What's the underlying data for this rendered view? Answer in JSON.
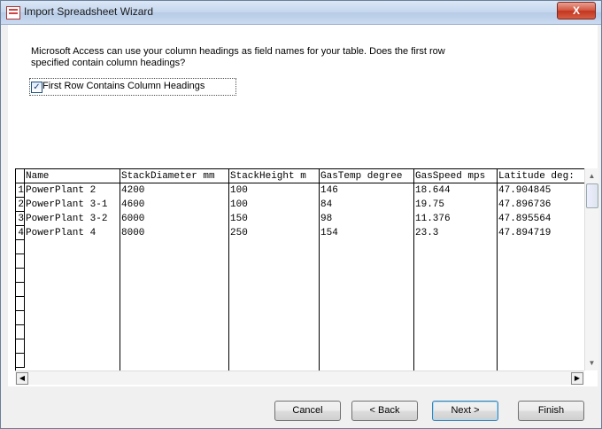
{
  "window": {
    "title": "Import Spreadsheet Wizard",
    "close_label": "X"
  },
  "prompt": "Microsoft Access can use your column headings as field names for your table. Does the first row specified contain column headings?",
  "checkbox": {
    "label": "First Row Contains Column Headings",
    "checked": true,
    "mark": "✓"
  },
  "grid": {
    "columns": [
      "Name",
      "StackDiameter mm",
      "StackHeight m",
      "GasTemp degree",
      "GasSpeed mps",
      "Latitude deg:"
    ],
    "rows": [
      {
        "num": "1",
        "cells": [
          "PowerPlant 2",
          "4200",
          "100",
          "146",
          "18.644",
          "47.904845"
        ]
      },
      {
        "num": "2",
        "cells": [
          "PowerPlant 3-1",
          "4600",
          "100",
          "84",
          "19.75",
          "47.896736"
        ]
      },
      {
        "num": "3",
        "cells": [
          "PowerPlant 3-2",
          "6000",
          "150",
          "98",
          "11.376",
          "47.895564"
        ]
      },
      {
        "num": "4",
        "cells": [
          "PowerPlant 4",
          "8000",
          "250",
          "154",
          "23.3",
          "47.894719"
        ]
      }
    ]
  },
  "scroll": {
    "up": "▲",
    "down": "▼",
    "left": "◀",
    "right": "▶"
  },
  "buttons": {
    "cancel": "Cancel",
    "back": "< Back",
    "next": "Next >",
    "finish": "Finish"
  }
}
